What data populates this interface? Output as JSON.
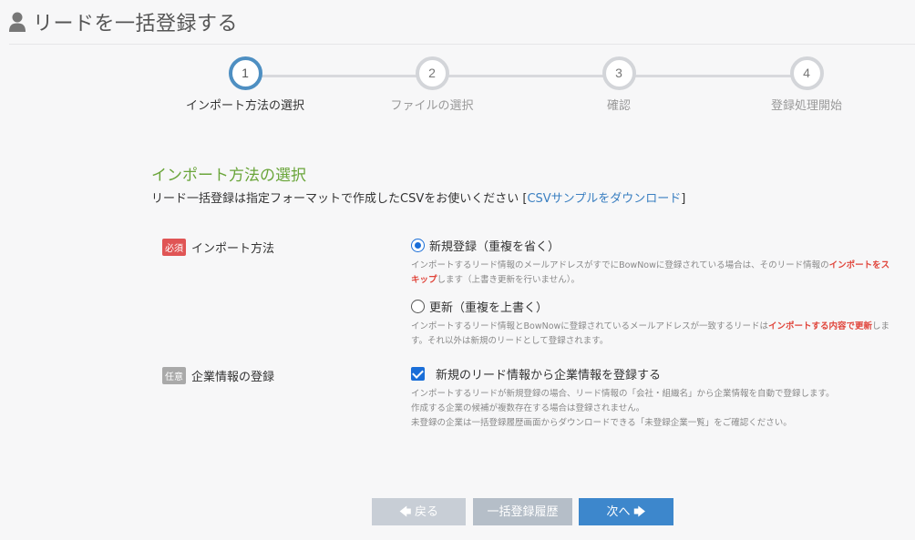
{
  "header": {
    "title": "リードを一括登録する",
    "icon": "user-icon"
  },
  "stepper": {
    "steps": [
      {
        "number": "1",
        "label": "インポート方法の選択",
        "active": true
      },
      {
        "number": "2",
        "label": "ファイルの選択",
        "active": false
      },
      {
        "number": "3",
        "label": "確認",
        "active": false
      },
      {
        "number": "4",
        "label": "登録処理開始",
        "active": false
      }
    ]
  },
  "section": {
    "title": "インポート方法の選択",
    "desc_prefix": "リード一括登録は指定フォーマットで作成したCSVをお使いください [",
    "desc_link": "CSVサンプルをダウンロード",
    "desc_suffix": "]"
  },
  "import_method": {
    "badge": "必須",
    "label": "インポート方法",
    "options": [
      {
        "label": "新規登録（重複を省く）",
        "checked": true,
        "help_1": "インポートするリード情報のメールアドレスがすでにBowNowに登録されている場合は、そのリード情報の",
        "help_bold_1": "インポートをスキップ",
        "help_2": "します（上書き更新を行いません）。"
      },
      {
        "label": "更新（重複を上書く）",
        "checked": false,
        "help_1": "インポートするリード情報とBowNowに登録されているメールアドレスが一致するリードは",
        "help_bold_1": "インポートする内容で更新",
        "help_2": "します。それ以外は新規のリードとして登録されます。"
      }
    ]
  },
  "company_registration": {
    "badge": "任意",
    "label": "企業情報の登録",
    "checkbox_label": "新規のリード情報から企業情報を登録する",
    "checked": true,
    "help_lines": [
      "インポートするリードが新規登録の場合、リード情報の「会社・組織名」から企業情報を自動で登録します。",
      "作成する企業の候補が複数存在する場合は登録されません。",
      "未登録の企業は一括登録履歴画面からダウンロードできる「未登録企業一覧」をご確認ください。"
    ]
  },
  "buttons": {
    "back": "戻る",
    "history": "一括登録履歴",
    "next": "次へ"
  },
  "colors": {
    "accent": "#3d87cc",
    "section_title": "#6aa53a",
    "required": "#e05555",
    "optional": "#a9a9a9",
    "emphasis": "#e0443a"
  }
}
